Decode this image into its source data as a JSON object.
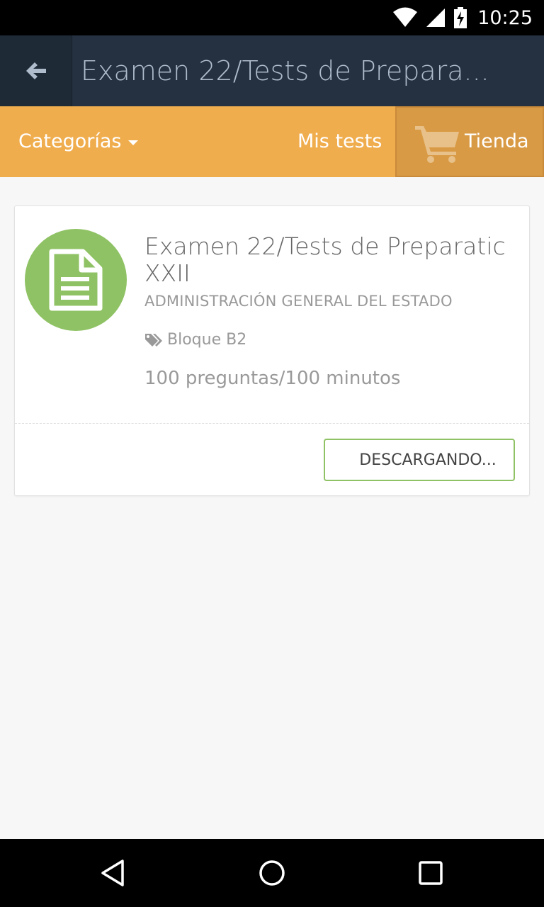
{
  "status_bar": {
    "time": "10:25",
    "icons": [
      "wifi-icon",
      "signal-icon",
      "battery-icon"
    ]
  },
  "header": {
    "back_icon": "arrow-left-icon",
    "title": "Examen 22/Tests de Prepara..."
  },
  "nav": {
    "categories_label": "Categorías",
    "my_tests_label": "Mis tests",
    "store_label": "Tienda",
    "store_icon": "cart-icon"
  },
  "card": {
    "icon": "document-icon",
    "title": "Examen 22/Tests de Preparatic XXII",
    "subtitle": "ADMINISTRACIÓN GENERAL DEL ESTADO",
    "tag_icon": "tags-icon",
    "tag": "Bloque B2",
    "meta": "100 preguntas/100 minutos",
    "button_label": "DESCARGANDO..."
  },
  "system_nav": {
    "buttons": [
      "back-triangle-icon",
      "home-circle-icon",
      "recents-square-icon"
    ]
  },
  "colors": {
    "header_bg": "#253140",
    "nav_bg": "#f0ad4e",
    "store_bg": "#d99a45",
    "icon_green": "#8fc264"
  }
}
